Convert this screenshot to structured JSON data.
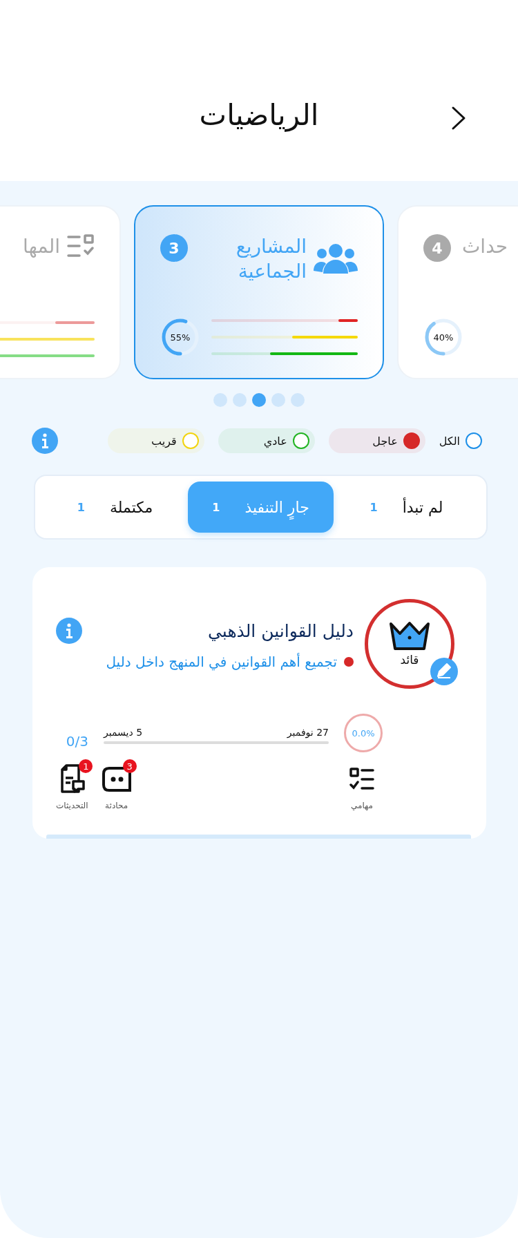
{
  "header": {
    "title": "الرياضيات"
  },
  "categories": [
    {
      "title": "حداث",
      "count": "4",
      "percent": "40%",
      "selected": false
    },
    {
      "title": "المشاريع الجماعية",
      "kind": "group",
      "count": "3",
      "percent": "55%",
      "selected": true,
      "bars": [
        {
          "level": 0.13,
          "color": "#e02424"
        },
        {
          "level": 0.45,
          "color": "#f5d90a"
        },
        {
          "level": 0.6,
          "color": "#14b814"
        }
      ]
    },
    {
      "title": "المها",
      "kind": "checklist",
      "selected": false,
      "bars": [
        {
          "level": 0.2,
          "color": "#ec9a9a"
        },
        {
          "level": 0.5,
          "color": "#f8e35c"
        },
        {
          "level": 0.75,
          "color": "#86dd86"
        }
      ]
    }
  ],
  "dots": [
    {
      "selected": false
    },
    {
      "selected": false
    },
    {
      "selected": true
    },
    {
      "selected": false
    },
    {
      "selected": false
    }
  ],
  "filters": [
    {
      "label": "الكل",
      "kind": "all",
      "color": "#1e90e8",
      "selected": false
    },
    {
      "label": "عاجل",
      "kind": "priority",
      "color": "#d62828",
      "selected": true
    },
    {
      "label": "عادي",
      "kind": "priority",
      "color": "#22b422",
      "selected": false
    },
    {
      "label": "قريب",
      "kind": "priority",
      "color": "#f2d40f",
      "selected": false
    }
  ],
  "status_tabs": [
    {
      "label": "لم تبدأ",
      "count": "1",
      "selected": false
    },
    {
      "label": "جارٍ التنفيذ",
      "count": "1",
      "selected": true
    },
    {
      "label": "مكتملة",
      "count": "1",
      "selected": false
    }
  ],
  "project": {
    "leader_label": "قائد",
    "title": "دليل القوانين الذهبي",
    "description": "تجميع أهم القوانين في المنهج داخل دليل",
    "percent": "0.0%",
    "start_date": "27 نوفمبر",
    "end_date": "5 ديسمبر",
    "tasks_count": "0/3",
    "actions": [
      {
        "label": "مهامي",
        "kind": "tasks"
      },
      {
        "label": "محادثة",
        "kind": "chat",
        "badge": "3"
      },
      {
        "label": "التحديثات",
        "kind": "updates",
        "badge": "1"
      }
    ]
  }
}
